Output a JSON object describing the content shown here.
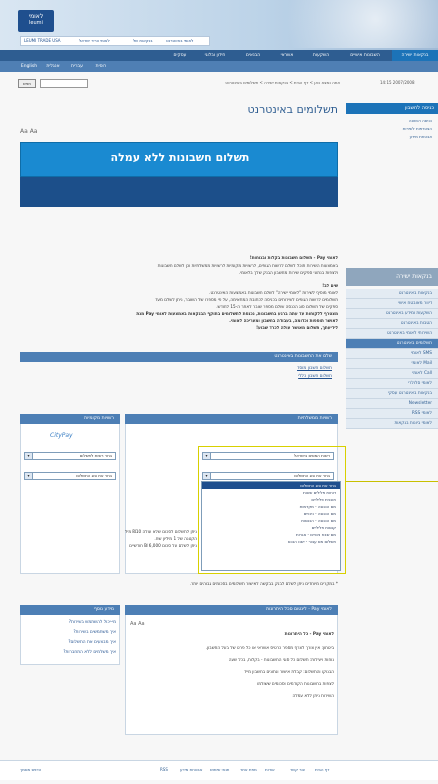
{
  "header": {
    "logo_text_1": "לאומי",
    "logo_text_2": "leumi",
    "trade_links": [
      "LEUMI TRADE USA",
      "לאומי ווריר ישראל",
      "בנקאות של",
      "לאומי באינטרנט"
    ]
  },
  "topnav": [
    "בנקאות ישירה",
    "השבונות אישיים",
    "השקעות",
    "אשראי",
    "הבנאים",
    "חידון ובלוגי",
    "עסקים"
  ],
  "subnav": [
    "English",
    "אנגלית",
    "עברית",
    "רוסית"
  ],
  "search": {
    "button": "חפש",
    "placeholder": ""
  },
  "breadcrumb": "אתה נמצא כאן > דף הבית > בנקאות ישירה > תשלומים באינטרנט",
  "date": "14:15  2007/2008",
  "page": {
    "title": "תשלומים באינטרנט",
    "font_controls": "Aa Aa",
    "banner_title": "תשלום חשבונות ללא עמלה"
  },
  "sidebar": {
    "login": "כניסה לחשבון",
    "links": [
      "כניסה רגשונה",
      "הצטרפות לשירות",
      "אבטחת מידע"
    ],
    "section_title": "בנקאות ישירה",
    "items": [
      "בנקאות באינטרנט",
      "דיוור מאובטח אישי",
      "השקעות ומידע באינטרנט",
      "הטבות באינטרנט",
      "השירותי לאומי באינטרנט",
      "תשלומים באינטרנט",
      "לאומי SMS",
      "לאומי Mail",
      "לאומי Call",
      "לאומי סלולרי",
      "בנקאות באינטרנט עסקי",
      "Newsletter",
      "RSS לאומי",
      "לאומי ביונות בנקאות"
    ],
    "active_index": 5
  },
  "intro": {
    "line1": "לאומי Pay - תשלום חשבונות בקלות ובנוחות!",
    "line2": "באמצעות השירות תוכל לשלם לרשות הגופים, לרשויות מקומיות לרשויות ממשלתיות וכן לשלם חשבונות",
    "line3": "ולצפות בנתוני ספקים שירות מחשבון הבנק שלך בלאומי.",
    "new_head": "שים לב!",
    "new1": "לאומי מוסיף לשירות \"לאומי ישירה\" לשלם חשבונות באמצעות האינטרנט.",
    "new2": "תשלומים לרשות הגופים לשירותים בכניסה לכתובת המתאימה, על פי מספרו של השובר, ניתן לשלם מעד",
    "new3": "ספקים של תשלום סוג הכנסה שולם מספר שובר לאתר ה-15 לחודש.",
    "new4": "מצטרף ללקוחות עד עתה ברגע בחשבונות, נכנסת לתשלומים בתוקף הבנקאות באמצעות לאומי Pay מנת",
    "new5": "לאושר תוספות וכדומה, בעבודה בחשבון ומעריכה לאומי.",
    "new6": "לידיעתך, תשלום מאושר עולה לכרד שבוע!"
  },
  "pay_section": {
    "bar": "שלם את החשבונות באינטרנט",
    "links": [
      "תשלום חשבון מוסד",
      "תשלום חשבון כללי"
    ]
  },
  "gov_section": {
    "bar": "רשויות ממשלתיות",
    "select1": "רשות המסים בישראל",
    "select2": "בחר את סוג התשלום",
    "dropdown": [
      "בחר את סוג התשלום",
      "דוחות פלילים שונות",
      "תוכנית פליליים",
      "מס הכנסה - מקדמות",
      "מס הכנסה - ניכויים",
      "מס הכנסה - הכנסות",
      "קנסות פליליים",
      "מס שבח ניכויים - אגרות",
      "תשלום מס עבור - ישנו הנכס"
    ]
  },
  "local_section": {
    "bar": "רשויות מקומיות",
    "logo": "CityPay",
    "select1": "בחר רשות לתשלום",
    "select2": "בחר את סוג התשלום"
  },
  "notes": {
    "n1": "ניתן לתשלום לסכום שלא עולה ₪10 מיליון של",
    "n2": "הקטנה של 1 מיליון שח.",
    "n3": "ניתן לשלם על סכום 6,000 ₪ חודשיים",
    "n4": "* במקרים מיוחדים ניתן לשלם לבנק בבקשה לאישור תשלומים בסכומים גבוהים יותר."
  },
  "info_box": {
    "bar": "לאומי Pay - לינטום סכל היתרונות",
    "font_controls": "Aa Aa",
    "head": "לאומי Pay - כל היתרונות",
    "bullets": [
      "ביטחון: אין צורך לצרף מספר כרטיס אשראי או כל פרט של בעל החשבון.",
      "נוחות ויעילות: תשלום כל סוגי החשבונות - בקלות, בכל שעה",
      "הבנוקו והתשלום: קבלת אישור ונתונים בחשבון מייד",
      "לצפות בחשבונות הקודמים וסכומים ששולמו",
      "השירות ניתן ללא עמלה"
    ]
  },
  "more_info": {
    "bar": "מידע נוסף",
    "links": [
      "מי-יכול להשתמש בשירות?",
      "איך משתמשים בשירות?",
      "איך מבצעים את התשלום?",
      "איך משלמים ללא התחברות?"
    ]
  },
  "footer": {
    "links": [
      "דף הבית",
      "צור קשר",
      "אודות",
      "מפת אתר",
      "תנאי שימוש",
      "אבטחת מידע",
      "RSS"
    ],
    "print": "הדפס מסמך"
  }
}
